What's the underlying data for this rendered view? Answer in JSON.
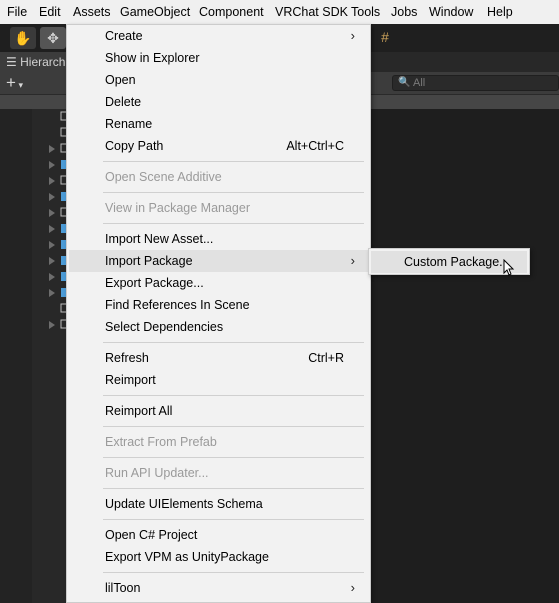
{
  "menubar": {
    "items": [
      "File",
      "Edit",
      "Assets",
      "GameObject",
      "Component",
      "VRChat SDK",
      "Tools",
      "Jobs",
      "Window",
      "Help"
    ]
  },
  "hierarchy": {
    "tab_label": "Hierarch",
    "search_placeholder": "All"
  },
  "assets_menu": {
    "items": [
      {
        "label": "Create",
        "submenu": true
      },
      {
        "label": "Show in Explorer"
      },
      {
        "label": "Open"
      },
      {
        "label": "Delete"
      },
      {
        "label": "Rename"
      },
      {
        "label": "Copy Path",
        "shortcut": "Alt+Ctrl+C"
      },
      {
        "label": "Open Scene Additive",
        "disabled": true
      },
      {
        "label": "View in Package Manager",
        "disabled": true
      },
      {
        "label": "Import New Asset..."
      },
      {
        "label": "Import Package",
        "submenu": true,
        "highlighted": true
      },
      {
        "label": "Export Package..."
      },
      {
        "label": "Find References In Scene"
      },
      {
        "label": "Select Dependencies"
      },
      {
        "label": "Refresh",
        "shortcut": "Ctrl+R"
      },
      {
        "label": "Reimport"
      },
      {
        "label": "Reimport All"
      },
      {
        "label": "Extract From Prefab",
        "disabled": true
      },
      {
        "label": "Run API Updater...",
        "disabled": true
      },
      {
        "label": "Update UIElements Schema"
      },
      {
        "label": "Open C# Project"
      },
      {
        "label": "Export VPM as UnityPackage"
      },
      {
        "label": "lilToon",
        "submenu": true
      }
    ]
  },
  "import_package_submenu": {
    "items": [
      {
        "label": "Custom Package..."
      }
    ]
  },
  "colors": {
    "menu_bg": "#f2f2f2",
    "highlight": "#e1e1e1",
    "disabled_text": "#9a9a9a",
    "editor_bg": "#1e1e1e"
  }
}
